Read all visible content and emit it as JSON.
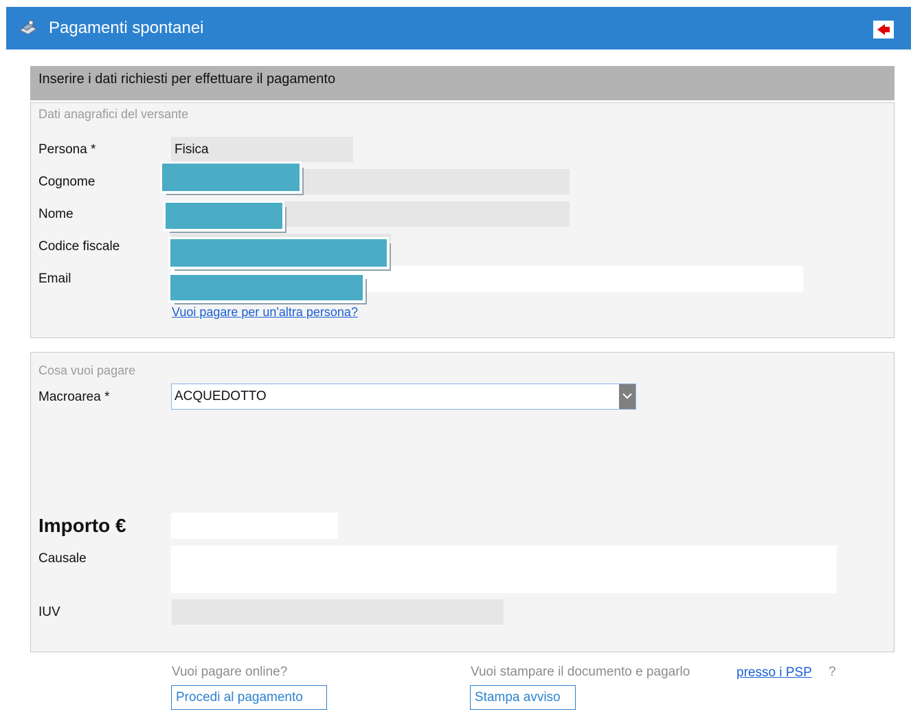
{
  "header": {
    "title": "Pagamenti spontanei",
    "icon": "payment-icon",
    "back_icon": "back-arrow-icon",
    "color": "#2d82d0"
  },
  "intro": "Inserire i dati richiesti per effettuare il pagamento",
  "anagrafica": {
    "section_title": "Dati anagrafici del versante",
    "persona_label": "Persona *",
    "persona_value": "Fisica",
    "cognome_label": "Cognome",
    "nome_label": "Nome",
    "codice_fiscale_label": "Codice fiscale",
    "email_label": "Email",
    "other_person_link": "Vuoi pagare per un'altra persona?"
  },
  "pagamento": {
    "section_title": "Cosa vuoi pagare",
    "macroarea_label": "Macroarea *",
    "macroarea_value": "ACQUEDOTTO",
    "importo_label": "Importo €",
    "causale_label": "Causale",
    "iuv_label": "IUV"
  },
  "footer": {
    "online_question": "Vuoi pagare online?",
    "procedi_button": "Procedi al pagamento",
    "print_question": "Vuoi stampare il documento e pagarlo",
    "psp_link": "presso i PSP",
    "question_mark": "?",
    "stampa_button": "Stampa avviso"
  }
}
